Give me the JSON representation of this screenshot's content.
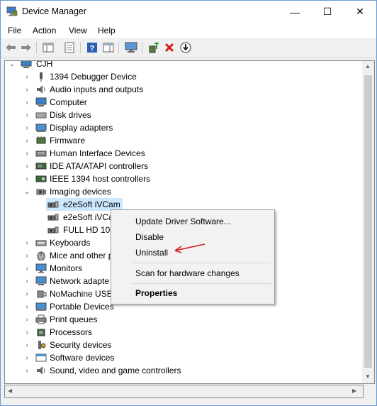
{
  "window": {
    "title": "Device Manager",
    "minimize_glyph": "—",
    "maximize_glyph": "☐",
    "close_glyph": "✕"
  },
  "menubar": {
    "items": [
      "File",
      "Action",
      "View",
      "Help"
    ]
  },
  "toolbar": {
    "buttons": [
      "back-icon",
      "forward-icon",
      "show-hide-console-tree-icon",
      "properties-icon",
      "help-icon",
      "action-pane-icon",
      "monitor-icon",
      "update-driver-icon",
      "uninstall-x-icon",
      "disable-down-icon"
    ]
  },
  "tree": {
    "root": "CJH",
    "items": [
      {
        "label": "1394 Debugger Device",
        "icon": "probe-icon"
      },
      {
        "label": "Audio inputs and outputs",
        "icon": "speaker-icon"
      },
      {
        "label": "Computer",
        "icon": "computer-icon"
      },
      {
        "label": "Disk drives",
        "icon": "disk-icon"
      },
      {
        "label": "Display adapters",
        "icon": "display-icon"
      },
      {
        "label": "Firmware",
        "icon": "firmware-icon"
      },
      {
        "label": "Human Interface Devices",
        "icon": "hid-icon"
      },
      {
        "label": "IDE ATA/ATAPI controllers",
        "icon": "ide-icon"
      },
      {
        "label": "IEEE 1394 host controllers",
        "icon": "ieee-icon"
      },
      {
        "label": "Imaging devices",
        "icon": "camera-icon"
      },
      {
        "label": "e2eSoft iVCam",
        "icon": "webcam-icon"
      },
      {
        "label": "e2eSoft iVCa",
        "icon": "webcam-icon"
      },
      {
        "label": "FULL HD 108",
        "icon": "webcam-icon"
      },
      {
        "label": "Keyboards",
        "icon": "keyboard-icon"
      },
      {
        "label": "Mice and other p",
        "icon": "mouse-icon"
      },
      {
        "label": "Monitors",
        "icon": "monitor-icon"
      },
      {
        "label": "Network adapte",
        "icon": "network-icon"
      },
      {
        "label": "NoMachine USB",
        "icon": "usb-icon"
      },
      {
        "label": "Portable Devices",
        "icon": "portable-icon"
      },
      {
        "label": "Print queues",
        "icon": "printer-icon"
      },
      {
        "label": "Processors",
        "icon": "cpu-icon"
      },
      {
        "label": "Security devices",
        "icon": "security-icon"
      },
      {
        "label": "Software devices",
        "icon": "software-icon"
      },
      {
        "label": "Sound, video and game controllers",
        "icon": "sound-icon"
      }
    ]
  },
  "context_menu": {
    "update": "Update Driver Software...",
    "disable": "Disable",
    "uninstall": "Uninstall",
    "scan": "Scan for hardware changes",
    "properties": "Properties"
  },
  "colors": {
    "selection": "#cce8ff",
    "annotation_arrow": "#d42020"
  }
}
